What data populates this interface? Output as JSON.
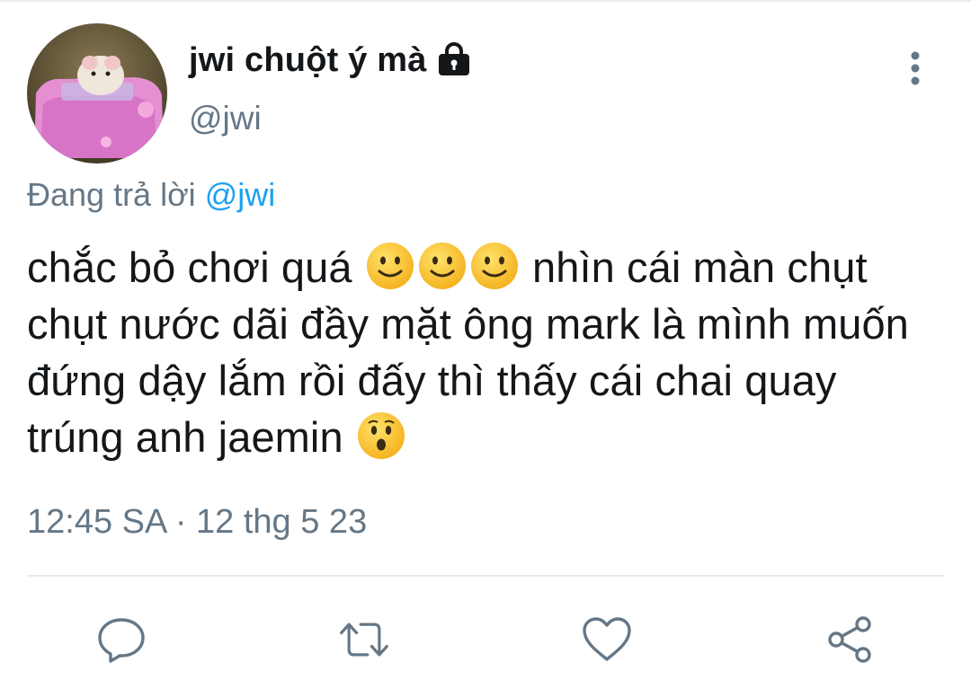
{
  "tweet": {
    "display_name": "jwi chuột ý mà",
    "handle": "@jwi",
    "reply_prefix": "Đang trả lời",
    "reply_mention": "@jwi",
    "text_part1": "chắc bỏ chơi quá ",
    "text_part2": " nhìn cái màn chụt chụt nước dãi đầy mặt ông mark là mình muốn đứng dậy lắm rồi đấy thì thấy cái chai quay trúng anh jaemin ",
    "time": "12:45 SA",
    "separator": "·",
    "date": "12 thg 5 23"
  },
  "icons": {
    "lock": "lock-icon",
    "more": "more-vertical-icon",
    "reply": "comment-icon",
    "retweet": "retweet-icon",
    "like": "heart-icon",
    "share": "share-icon",
    "emoji_smile": "slightly-smiling-face",
    "emoji_surprised": "hushed-face"
  },
  "colors": {
    "text": "#14171a",
    "secondary": "#657786",
    "link": "#1da1f2",
    "divider": "#e6ecf0"
  }
}
